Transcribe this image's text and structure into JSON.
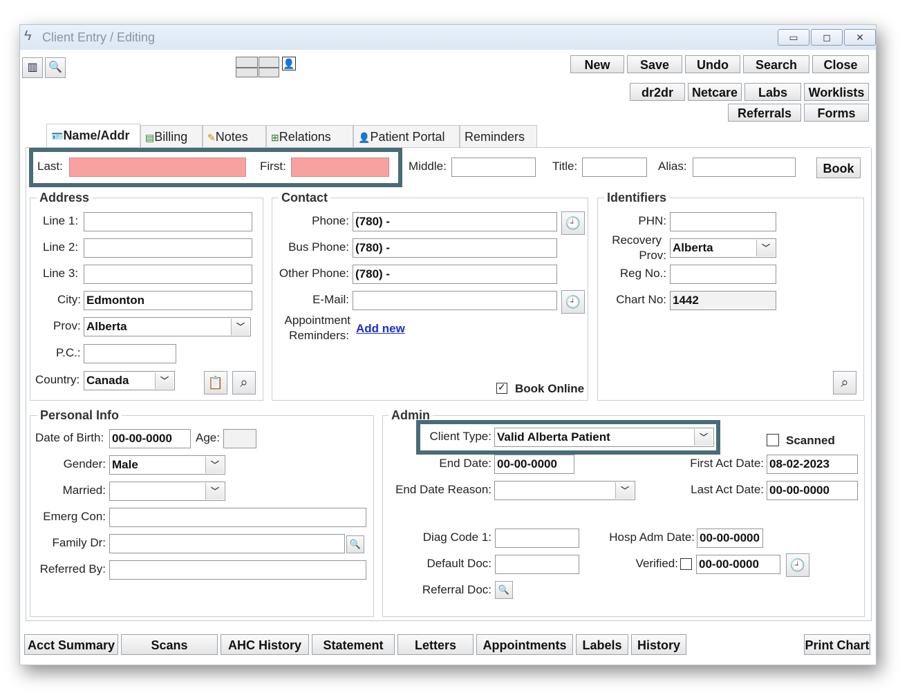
{
  "window": {
    "title": "Client Entry / Editing",
    "min": "▭",
    "max": "◻",
    "close": "✕"
  },
  "toolbar": {
    "new": "New",
    "save": "Save",
    "undo": "Undo",
    "search": "Search",
    "close": "Close",
    "dr2dr": "dr2dr",
    "netcare": "Netcare",
    "labs": "Labs",
    "worklists": "Worklists",
    "referrals": "Referrals",
    "forms": "Forms"
  },
  "tabs": [
    "Name/Addr",
    "Billing",
    "Notes",
    "Relations",
    "Patient Portal",
    "Reminders"
  ],
  "name": {
    "last_label": "Last:",
    "last_value": "",
    "first_label": "First:",
    "first_value": "",
    "middle_label": "Middle:",
    "middle_value": "",
    "title_label": "Title:",
    "title_value": "",
    "alias_label": "Alias:",
    "alias_value": "",
    "book": "Book",
    "redact_color": "#f7a1a1"
  },
  "address": {
    "title": "Address",
    "line1_label": "Line 1:",
    "line1": "",
    "line2_label": "Line 2:",
    "line2": "",
    "line3_label": "Line 3:",
    "line3": "",
    "city_label": "City:",
    "city": "Edmonton",
    "prov_label": "Prov:",
    "prov": "Alberta",
    "pc_label": "P.C.:",
    "pc": "",
    "country_label": "Country:",
    "country": "Canada"
  },
  "contact": {
    "title": "Contact",
    "phone_label": "Phone:",
    "phone": "(780)   -",
    "bus_phone_label": "Bus Phone:",
    "bus_phone": "(780)   -",
    "other_phone_label": "Other Phone:",
    "other_phone": "(780)   -",
    "email_label": "E-Mail:",
    "email": "",
    "appt_label_1": "Appointment",
    "appt_label_2": "Reminders:",
    "add_new": "Add new",
    "book_online": "Book Online",
    "book_online_checked": true
  },
  "identifiers": {
    "title": "Identifiers",
    "phn_label": "PHN:",
    "phn": "",
    "recovery_label_1": "Recovery",
    "recovery_label_2": "Prov:",
    "recovery_prov": "Alberta",
    "reg_label": "Reg No.:",
    "reg_no": "",
    "chart_label": "Chart No:",
    "chart_no": "1442"
  },
  "personal": {
    "title": "Personal Info",
    "dob_label": "Date of Birth:",
    "dob": "00-00-0000",
    "age_label": "Age:",
    "age": "",
    "gender_label": "Gender:",
    "gender": "Male",
    "married_label": "Married:",
    "married": "",
    "emerg_label": "Emerg Con:",
    "emerg": "",
    "family_dr_label": "Family Dr:",
    "family_dr": "",
    "referred_label": "Referred By:",
    "referred": ""
  },
  "admin": {
    "title": "Admin",
    "client_type_label": "Client Type:",
    "client_type": "Valid Alberta Patient",
    "scanned": "Scanned",
    "scanned_checked": false,
    "end_date_label": "End Date:",
    "end_date": "00-00-0000",
    "end_reason_label": "End Date Reason:",
    "end_reason": "",
    "first_act_label": "First Act Date:",
    "first_act": "08-02-2023",
    "last_act_label": "Last Act Date:",
    "last_act": "00-00-0000",
    "diag_label": "Diag Code 1:",
    "diag": "",
    "hosp_label": "Hosp Adm Date:",
    "hosp": "00-00-0000",
    "default_doc_label": "Default Doc:",
    "default_doc": "",
    "verified_label": "Verified:",
    "verified": "00-00-0000",
    "referral_doc_label": "Referral Doc:"
  },
  "bottom": {
    "acct_summary": "Acct Summary",
    "scans": "Scans",
    "ahc_history": "AHC History",
    "statement": "Statement",
    "letters": "Letters",
    "appointments": "Appointments",
    "labels": "Labels",
    "history": "History",
    "print_chart": "Print Chart"
  },
  "colors": {
    "highlight": "#4a6b78",
    "link": "#1a2fd0"
  }
}
